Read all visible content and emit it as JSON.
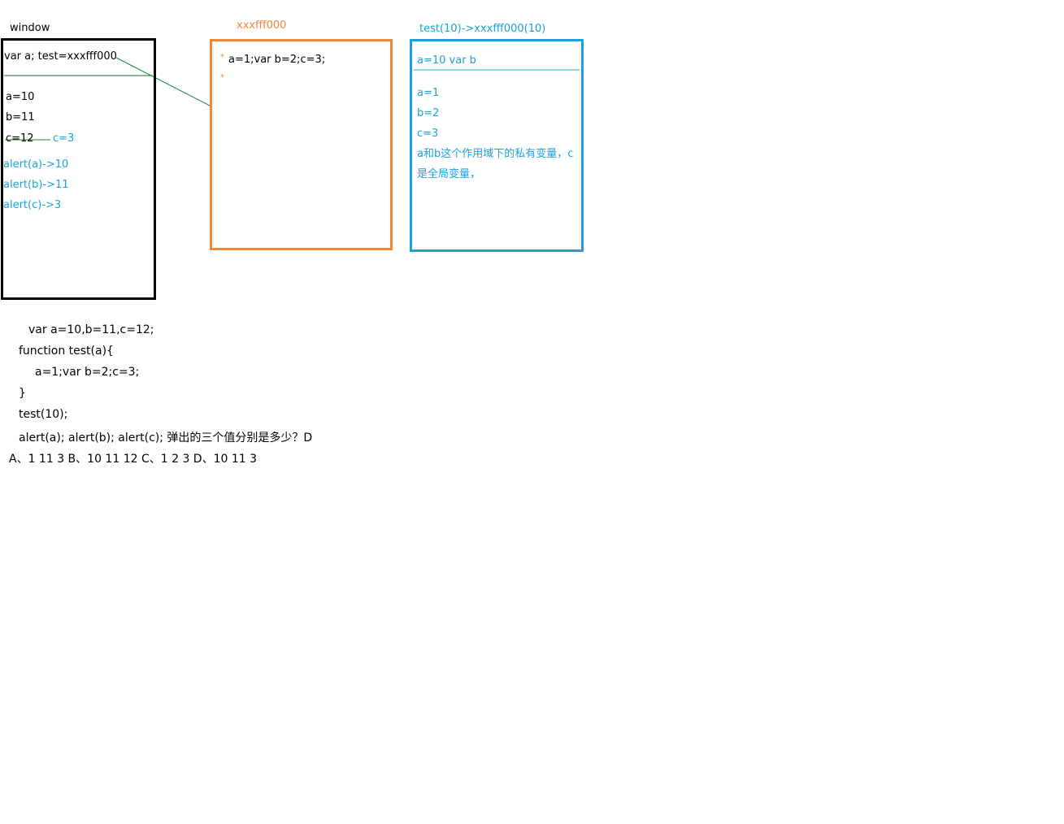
{
  "window": {
    "label": "window",
    "decl": "var a; test=xxxfff000",
    "vars": [
      "a=10",
      "b=11",
      "c=12"
    ],
    "c_new": "c=3",
    "alerts": [
      "alert(a)->10",
      "alert(b)->11",
      "alert(c)->3"
    ]
  },
  "heap": {
    "label": "xxxfff000",
    "bullet": "*",
    "line1": "a=1;var b=2;c=3;"
  },
  "scope": {
    "label": "test(10)->xxxfff000(10)",
    "header": "a=10 var b",
    "vars": [
      "a=1",
      "b=2",
      "c=3"
    ],
    "note": "a和b这个作用域下的私有变量，c是全局变量，"
  },
  "code": {
    "lines": [
      "var a=10,b=11,c=12;",
      "function test(a){",
      "a=1;var b=2;c=3;",
      "}",
      "test(10);",
      "alert(a);  alert(b);   alert(c);    弹出的三个值分别是多少？D"
    ],
    "options": "A、1 11 3    B、10 11 12   C、1 2 3    D、10 11 3"
  },
  "colors": {
    "window_border": "#000000",
    "heap_border": "#f0883a",
    "scope_border": "#1aa2dc",
    "link_line": "#1a8a3a"
  }
}
